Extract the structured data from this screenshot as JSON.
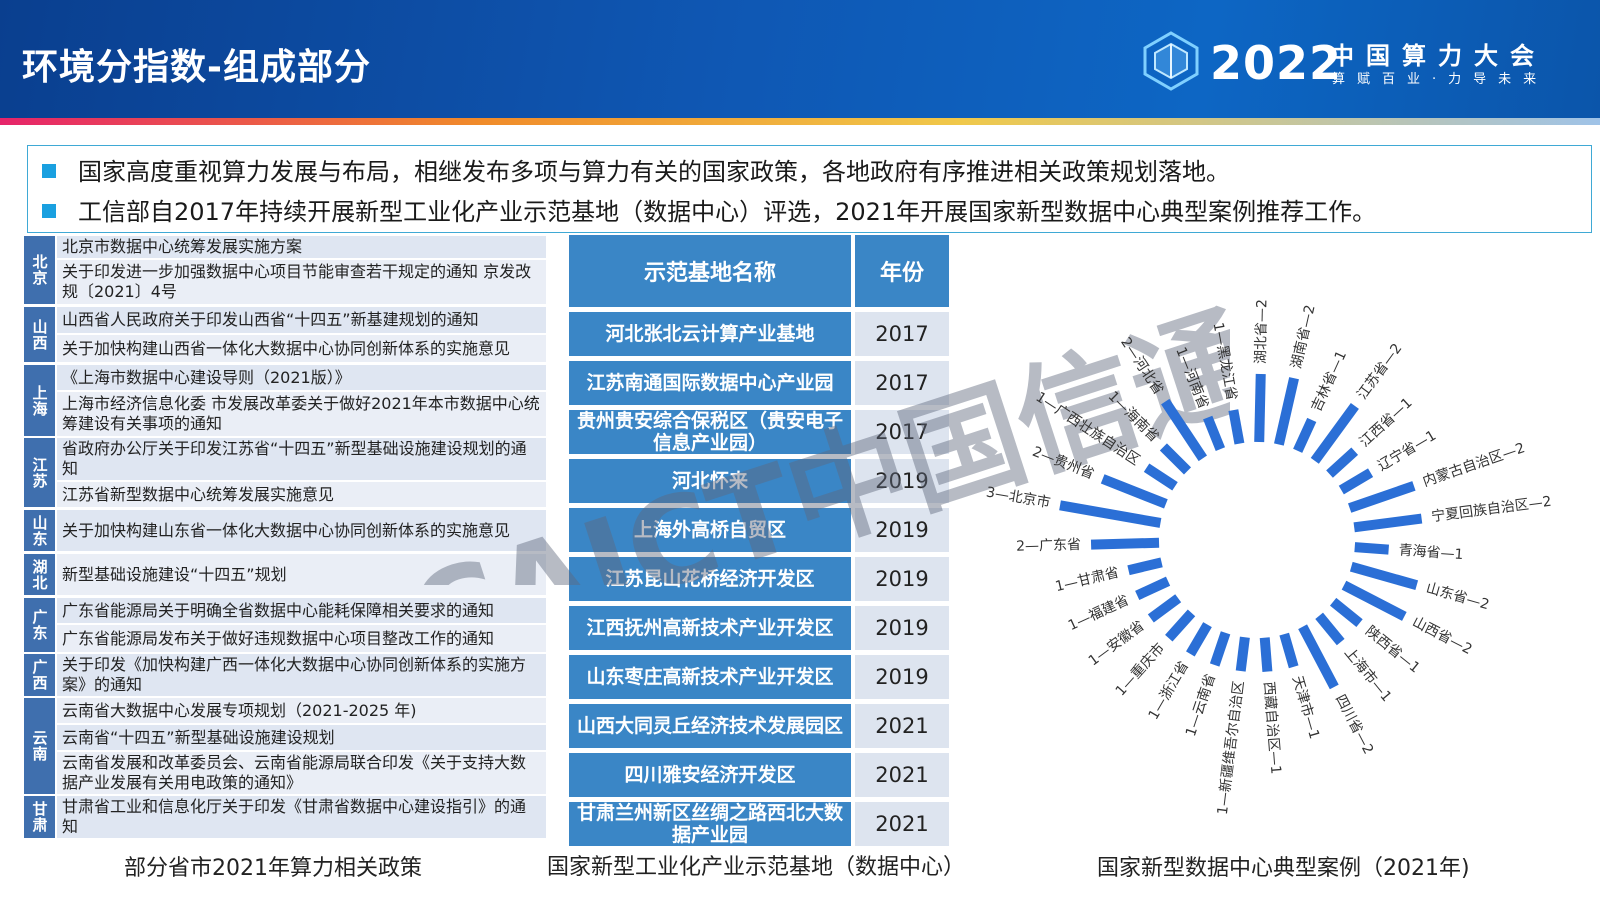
{
  "header": {
    "title": "环境分指数-组成部分",
    "logo_year": "2022",
    "logo_name": "中国算力大会",
    "logo_sub": "算赋百业·力导未来"
  },
  "bullets": [
    "国家高度重视算力发展与布局，相继发布多项与算力有关的国家政策，各地政府有序推进相关政策规划落地。",
    "工信部自2017年持续开展新型工业化产业示范基地（数据中心）评选，2021年开展国家新型数据中心典型案例推荐工作。"
  ],
  "policies": [
    {
      "province": "北京",
      "items": [
        "北京市数据中心统筹发展实施方案",
        "关于印发进一步加强数据中心项目节能审查若干规定的通知 京发改规〔2021〕4号"
      ]
    },
    {
      "province": "山西",
      "items": [
        "山西省人民政府关于印发山西省“十四五”新基建规划的通知",
        "关于加快构建山西省一体化大数据中心协同创新体系的实施意见"
      ]
    },
    {
      "province": "上海",
      "items": [
        "《上海市数据中心建设导则（2021版）》",
        "上海市经济信息化委 市发展改革委关于做好2021年本市数据中心统筹建设有关事项的通知"
      ]
    },
    {
      "province": "江苏",
      "items": [
        "省政府办公厅关于印发江苏省“十四五”新型基础设施建设规划的通知",
        "江苏省新型数据中心统筹发展实施意见"
      ]
    },
    {
      "province": "山东",
      "items": [
        "关于加快构建山东省一体化大数据中心协同创新体系的实施意见"
      ]
    },
    {
      "province": "湖北",
      "items": [
        "新型基础设施建设“十四五”规划"
      ]
    },
    {
      "province": "广东",
      "items": [
        "广东省能源局关于明确全省数据中心能耗保障相关要求的通知",
        "广东省能源局发布关于做好违规数据中心项目整改工作的通知"
      ]
    },
    {
      "province": "广西",
      "items": [
        "关于印发《加快构建广西一体化大数据中心协同创新体系的实施方案》的通知"
      ]
    },
    {
      "province": "云南",
      "items": [
        "云南省大数据中心发展专项规划（2021-2025 年)",
        "云南省“十四五”新型基础设施建设规划",
        "云南省发展和改革委员会、云南省能源局联合印发《关于支持大数据产业发展有关用电政策的通知》"
      ]
    },
    {
      "province": "甘肃",
      "items": [
        "甘肃省工业和信息化厅关于印发《甘肃省数据中心建设指引》的通知"
      ]
    }
  ],
  "captions": {
    "policy": "部分省市2021年算力相关政策",
    "bases": "国家新型工业化产业示范基地（数据中心）",
    "cases": "国家新型数据中心典型案例（2021年)"
  },
  "bases_table": {
    "header_name": "示范基地名称",
    "header_year": "年份",
    "rows": [
      {
        "name": "河北张北云计算产业基地",
        "year": "2017"
      },
      {
        "name": "江苏南通国际数据中心产业园",
        "year": "2017"
      },
      {
        "name": "贵州贵安综合保税区（贵安电子信息产业园）",
        "year": "2017"
      },
      {
        "name": "河北怀来",
        "year": "2019"
      },
      {
        "name": "上海外高桥自贸区",
        "year": "2019"
      },
      {
        "name": "江苏昆山花桥经济开发区",
        "year": "2019"
      },
      {
        "name": "江西抚州高新技术产业开发区",
        "year": "2019"
      },
      {
        "name": "山东枣庄高新技术产业开发区",
        "year": "2019"
      },
      {
        "name": "山西大同灵丘经济技术发展园区",
        "year": "2021"
      },
      {
        "name": "四川雅安经济开发区",
        "year": "2021"
      },
      {
        "name": "甘肃兰州新区丝绸之路西北大数据产业园",
        "year": "2021"
      }
    ]
  },
  "watermark": "CAICT中国信通院",
  "colors": {
    "header": "#0f57b3",
    "accent": "#1aa0e0",
    "bar": "#2b6fd6",
    "table_blue": "#3a86c6"
  },
  "chart_data": {
    "type": "radial-bar",
    "categories": [
      "北京市",
      "贵州省",
      "广西壮族自治区",
      "海南省",
      "河北省",
      "河南省",
      "黑龙江省",
      "湖北省",
      "湖南省",
      "吉林省",
      "江苏省",
      "江西省",
      "辽宁省",
      "内蒙古自治区",
      "宁夏回族自治区",
      "青海省",
      "山东省",
      "山西省",
      "陕西省",
      "上海市",
      "四川省",
      "天津市",
      "西藏自治区",
      "新疆维吾尔自治区",
      "云南省",
      "浙江省",
      "重庆市",
      "安徽省",
      "福建省",
      "甘肃省",
      "广东省"
    ],
    "values": [
      3,
      2,
      1,
      1,
      2,
      1,
      1,
      2,
      2,
      1,
      2,
      1,
      1,
      2,
      2,
      1,
      2,
      2,
      1,
      1,
      2,
      1,
      1,
      1,
      1,
      1,
      1,
      1,
      1,
      1,
      2
    ]
  }
}
